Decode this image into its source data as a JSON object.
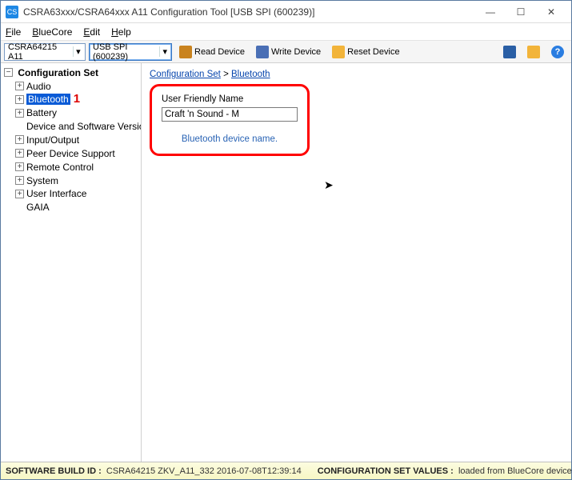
{
  "title": "CSRA63xxx/CSRA64xxx A11 Configuration Tool [USB SPI (600239)]",
  "menu": {
    "file": "File",
    "bluecore": "BlueCore",
    "edit": "Edit",
    "help": "Help"
  },
  "toolbar": {
    "combo1": "CSRA64215 A11",
    "combo2": "USB SPI (600239)",
    "read": "Read Device",
    "write": "Write Device",
    "reset": "Reset Device"
  },
  "tree": {
    "root": "Configuration Set",
    "items": [
      "Audio",
      "Bluetooth",
      "Battery",
      "Device and Software Version",
      "Input/Output",
      "Peer Device Support",
      "Remote Control",
      "System",
      "User Interface",
      "GAIA"
    ],
    "selected_index": 1,
    "annotation": "1"
  },
  "breadcrumb": {
    "a": "Configuration Set",
    "b": "Bluetooth",
    "sep": " > "
  },
  "panel": {
    "label": "User Friendly Name",
    "value": "Craft 'n Sound - M",
    "desc": "Bluetooth device name."
  },
  "status": {
    "build_label": "SOFTWARE BUILD ID :",
    "build_value": "CSRA64215 ZKV_A11_332 2016-07-08T12:39:14",
    "conf_label": "CONFIGURATION SET VALUES :",
    "conf_value": "loaded from BlueCore device"
  },
  "icons": {
    "help_char": "?",
    "cursor": "↖"
  }
}
